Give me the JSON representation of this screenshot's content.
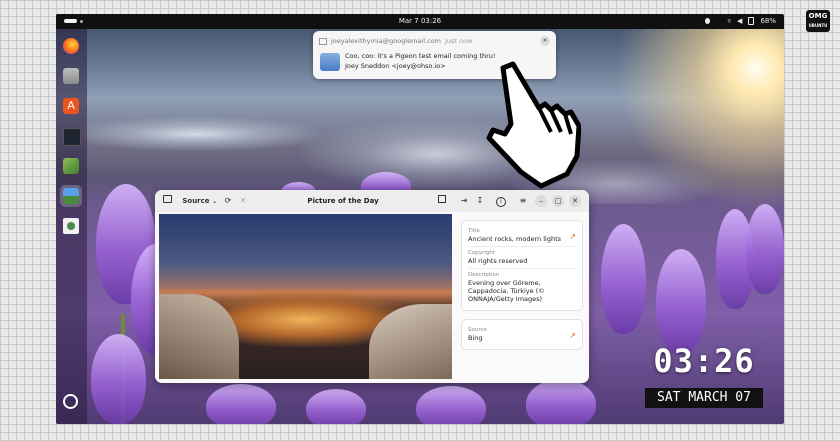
{
  "topbar": {
    "clock": "Mar 7  03:26",
    "battery": "68%"
  },
  "dock": {
    "apps": [
      {
        "name": "firefox",
        "color": "#ff7b1e"
      },
      {
        "name": "files",
        "color": "#a8a8a8"
      },
      {
        "name": "app-center",
        "color": "#e95420"
      },
      {
        "name": "terminal",
        "color": "#2d2d2d"
      },
      {
        "name": "extensions",
        "color": "#6aa84f"
      },
      {
        "name": "picture-of-the-day",
        "color": "#3a6fb7"
      },
      {
        "name": "trash",
        "color": "#4d8a4d"
      }
    ],
    "show_apps_icon": "ubuntu-icon"
  },
  "notification": {
    "sender": "joeyalexithymia@googlemail.com",
    "time": "Just now",
    "subject": "Coo, coo: it's a Pigeon test email coming thru!",
    "from": "Joey Sneddon <joey@ohso.io>",
    "close_glyph": "×"
  },
  "window": {
    "source_label": "Source",
    "title": "Picture of the Day",
    "details": [
      {
        "label": "Title",
        "value": "Ancient rocks, modern lights",
        "link": true
      },
      {
        "label": "Copyright",
        "value": "All rights reserved",
        "link": false
      },
      {
        "label": "Description",
        "value": "Evening over Göreme, Cappadocia, Türkiye (© ONNAJA/Getty Images)",
        "link": false
      }
    ],
    "source": {
      "label": "Source",
      "value": "Bing"
    }
  },
  "overlay": {
    "time": "03:26",
    "date": "SAT MARCH 07"
  },
  "watermark": {
    "text": "OMG UBUNTU"
  }
}
